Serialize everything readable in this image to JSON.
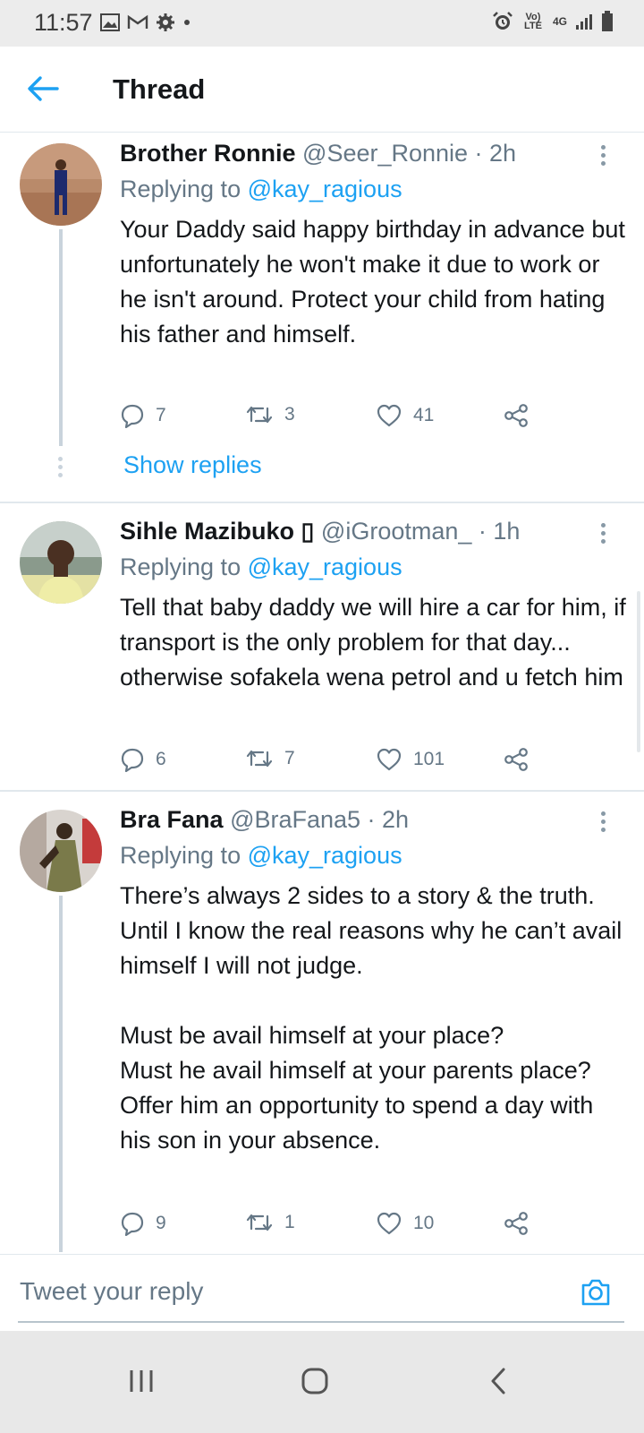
{
  "status_bar": {
    "time": "11:57",
    "left_icons": [
      "gallery-icon",
      "gmail-icon",
      "settings-icon",
      "dot-icon"
    ],
    "right_icons": [
      "alarm-icon",
      "volte-icon",
      "4g-icon",
      "signal-icon",
      "battery-icon"
    ],
    "volte_label": "Vo) LTE",
    "network_label": "4G"
  },
  "header": {
    "title": "Thread",
    "accent_color": "#1da1f2"
  },
  "tweets": [
    {
      "name": "Brother Ronnie",
      "handle": "@Seer_Ronnie · 2h",
      "replying_prefix": "Replying to ",
      "replying_to": "@kay_ragious",
      "text": "Your Daddy said happy birthday in advance but unfortunately he won't make it due to work or he isn't around. Protect your child from hating his father and himself.",
      "replies": "7",
      "retweets": "3",
      "likes": "41",
      "show_replies": "Show replies"
    },
    {
      "name": "Sihle Mazibuko",
      "name_emoji": "▯",
      "handle": "@iGrootman_ · 1h",
      "replying_prefix": "Replying to ",
      "replying_to": "@kay_ragious",
      "text": "Tell that baby daddy we will hire a car for him, if transport is the only problem for that day... otherwise sofakela wena petrol and u fetch him",
      "replies": "6",
      "retweets": "7",
      "likes": "101"
    },
    {
      "name": "Bra Fana",
      "handle": "@BraFana5 · 2h",
      "replying_prefix": "Replying to ",
      "replying_to": "@kay_ragious",
      "text": "There’s always 2 sides to a story & the truth. Until I know the real reasons why he can’t avail himself I will not judge.\n\nMust be avail himself at your place?\nMust he avail himself at your parents place?\nOffer him an opportunity to spend a day with his son in your absence.",
      "replies": "9",
      "retweets": "1",
      "likes": "10"
    }
  ],
  "composer": {
    "placeholder": "Tweet your reply"
  },
  "nav_bar": {
    "buttons": [
      "recents-icon",
      "home-icon",
      "back-icon"
    ]
  }
}
